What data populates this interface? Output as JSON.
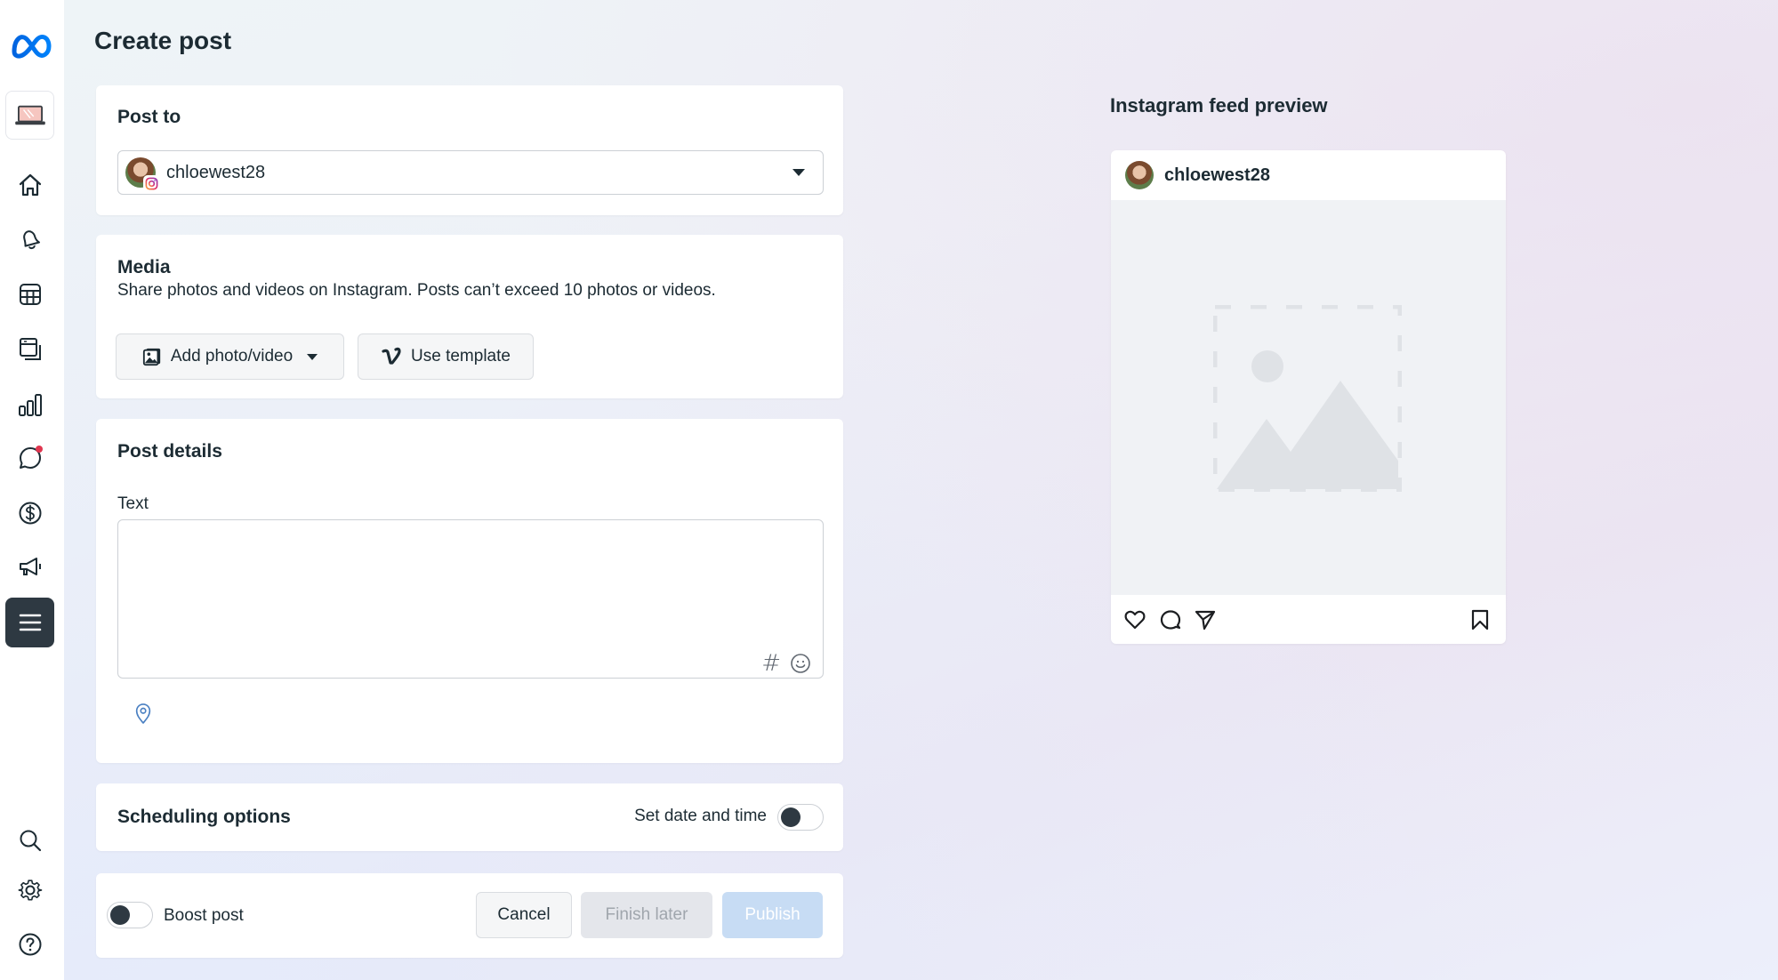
{
  "page": {
    "title": "Create post"
  },
  "sidebar": {
    "logo": "meta-logo-icon",
    "items": [
      {
        "name": "business-suite",
        "icon": "laptop-icon"
      },
      {
        "name": "home",
        "icon": "home-icon"
      },
      {
        "name": "notifications",
        "icon": "bell-icon"
      },
      {
        "name": "planner",
        "icon": "grid-icon"
      },
      {
        "name": "content",
        "icon": "pages-icon"
      },
      {
        "name": "insights",
        "icon": "bar-chart-icon"
      },
      {
        "name": "inbox",
        "icon": "chat-icon",
        "badge": true
      },
      {
        "name": "monetization",
        "icon": "dollar-icon"
      },
      {
        "name": "ads",
        "icon": "megaphone-icon"
      },
      {
        "name": "all-tools",
        "icon": "menu-icon",
        "active": true
      }
    ],
    "bottom_items": [
      {
        "name": "search",
        "icon": "search-icon"
      },
      {
        "name": "settings",
        "icon": "gear-icon"
      },
      {
        "name": "help",
        "icon": "help-icon"
      }
    ]
  },
  "post_to": {
    "title": "Post to",
    "selected_account": "chloewest28",
    "platform_badge": "instagram-icon"
  },
  "media": {
    "title": "Media",
    "description": "Share photos and videos on Instagram. Posts can’t exceed 10 photos or videos.",
    "add_button": "Add photo/video",
    "template_button": "Use template"
  },
  "post_details": {
    "title": "Post details",
    "text_label": "Text",
    "text_value": "",
    "hashtag_symbol": "#"
  },
  "scheduling": {
    "title": "Scheduling options",
    "toggle_label": "Set date and time",
    "toggle_on": false
  },
  "footer": {
    "boost_label": "Boost post",
    "boost_on": false,
    "cancel": "Cancel",
    "finish_later": "Finish later",
    "publish": "Publish"
  },
  "preview": {
    "title": "Instagram feed preview",
    "username": "chloewest28"
  },
  "colors": {
    "accent": "#0866ff",
    "dark": "#1c2b33",
    "publish_disabled_bg": "#c7dcf4",
    "finish_disabled_bg": "#e4e6eb",
    "notification": "#e0364f"
  }
}
